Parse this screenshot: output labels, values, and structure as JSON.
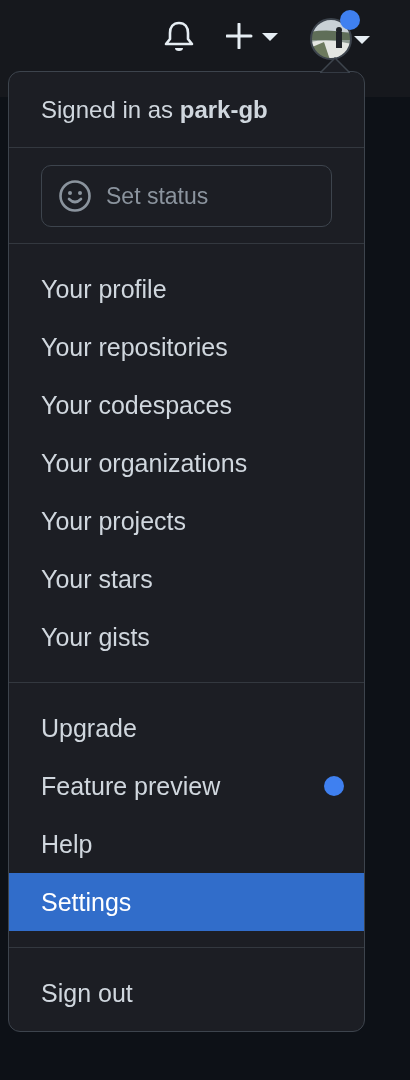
{
  "header": {
    "avatar_notification": true
  },
  "menu": {
    "signed_in_prefix": "Signed in as",
    "username": "park-gb",
    "status_button": "Set status",
    "sections": [
      {
        "items": [
          {
            "label": "Your profile",
            "selected": false,
            "indicator": false
          },
          {
            "label": "Your repositories",
            "selected": false,
            "indicator": false
          },
          {
            "label": "Your codespaces",
            "selected": false,
            "indicator": false
          },
          {
            "label": "Your organizations",
            "selected": false,
            "indicator": false
          },
          {
            "label": "Your projects",
            "selected": false,
            "indicator": false
          },
          {
            "label": "Your stars",
            "selected": false,
            "indicator": false
          },
          {
            "label": "Your gists",
            "selected": false,
            "indicator": false
          }
        ]
      },
      {
        "items": [
          {
            "label": "Upgrade",
            "selected": false,
            "indicator": false
          },
          {
            "label": "Feature preview",
            "selected": false,
            "indicator": true
          },
          {
            "label": "Help",
            "selected": false,
            "indicator": false
          },
          {
            "label": "Settings",
            "selected": true,
            "indicator": false
          }
        ]
      },
      {
        "items": [
          {
            "label": "Sign out",
            "selected": false,
            "indicator": false
          }
        ]
      }
    ]
  }
}
